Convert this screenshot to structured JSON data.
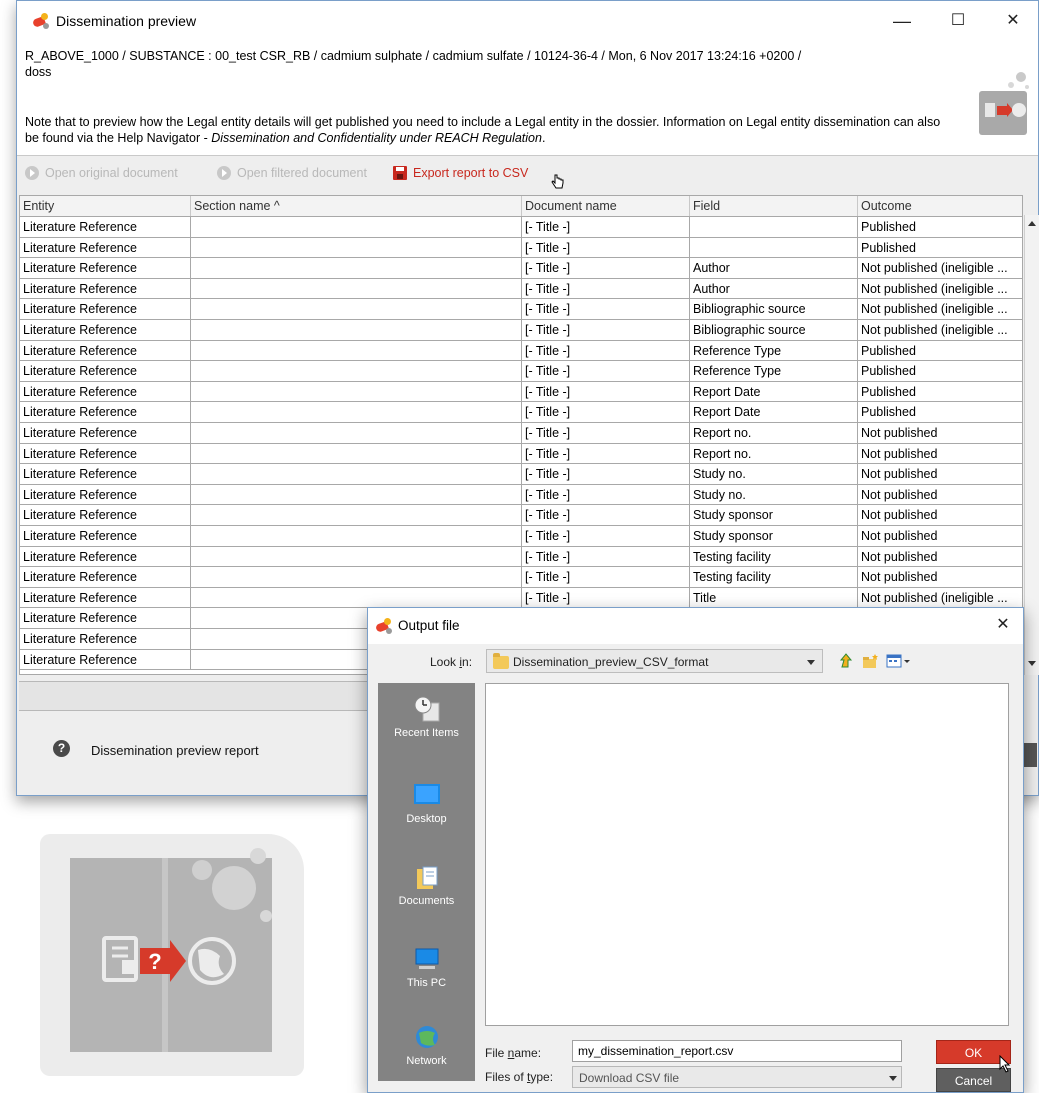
{
  "main_window": {
    "title": "Dissemination preview",
    "minimize": "—",
    "maximize": "☐",
    "close": "✕",
    "header_line1": "R_ABOVE_1000 / SUBSTANCE : 00_test CSR_RB / cadmium sulphate / cadmium sulfate / 10124-36-4 / Mon, 6 Nov 2017 13:24:16 +0200 /",
    "header_line2": "doss",
    "note_part1": "Note that to preview how the Legal entity details will get published you need to include a Legal entity in the dossier. Information on Legal entity dissemination can also be found via the Help Navigator - ",
    "note_italic": "Dissemination and Confidentiality under REACH Regulation",
    "note_end": "."
  },
  "toolbar": {
    "open_original": "Open original document",
    "open_filtered": "Open filtered document",
    "export_csv": "Export report to CSV"
  },
  "table": {
    "columns": [
      "Entity",
      "Section name ^",
      "Document name",
      "Field",
      "Outcome"
    ],
    "rows": [
      [
        "Literature Reference",
        "",
        "[- Title -]",
        "",
        "Published"
      ],
      [
        "Literature Reference",
        "",
        "[- Title -]",
        "",
        "Published"
      ],
      [
        "Literature Reference",
        "",
        "[- Title -]",
        "Author",
        "Not published (ineligible ..."
      ],
      [
        "Literature Reference",
        "",
        "[- Title -]",
        "Author",
        "Not published (ineligible ..."
      ],
      [
        "Literature Reference",
        "",
        "[- Title -]",
        "Bibliographic source",
        "Not published (ineligible ..."
      ],
      [
        "Literature Reference",
        "",
        "[- Title -]",
        "Bibliographic source",
        "Not published (ineligible ..."
      ],
      [
        "Literature Reference",
        "",
        "[- Title -]",
        "Reference Type",
        "Published"
      ],
      [
        "Literature Reference",
        "",
        "[- Title -]",
        "Reference Type",
        "Published"
      ],
      [
        "Literature Reference",
        "",
        "[- Title -]",
        "Report Date",
        "Published"
      ],
      [
        "Literature Reference",
        "",
        "[- Title -]",
        "Report Date",
        "Published"
      ],
      [
        "Literature Reference",
        "",
        "[- Title -]",
        "Report no.",
        "Not published"
      ],
      [
        "Literature Reference",
        "",
        "[- Title -]",
        "Report no.",
        "Not published"
      ],
      [
        "Literature Reference",
        "",
        "[- Title -]",
        "Study no.",
        "Not published"
      ],
      [
        "Literature Reference",
        "",
        "[- Title -]",
        "Study no.",
        "Not published"
      ],
      [
        "Literature Reference",
        "",
        "[- Title -]",
        "Study sponsor",
        "Not published"
      ],
      [
        "Literature Reference",
        "",
        "[- Title -]",
        "Study sponsor",
        "Not published"
      ],
      [
        "Literature Reference",
        "",
        "[- Title -]",
        "Testing facility",
        "Not published"
      ],
      [
        "Literature Reference",
        "",
        "[- Title -]",
        "Testing facility",
        "Not published"
      ],
      [
        "Literature Reference",
        "",
        "[- Title -]",
        "Title",
        "Not published (ineligible ..."
      ],
      [
        "Literature Reference",
        "",
        "",
        "",
        ""
      ],
      [
        "Literature Reference",
        "",
        "",
        "",
        ""
      ],
      [
        "Literature Reference",
        "",
        "",
        "",
        ""
      ]
    ]
  },
  "bottom": {
    "help_icon": "?",
    "report_label": "Dissemination preview report"
  },
  "output_dialog": {
    "title": "Output file",
    "close": "✕",
    "look_in_label": "Look in:",
    "look_in_value": "Dissemination_preview_CSV_format",
    "places": [
      "Recent Items",
      "Desktop",
      "Documents",
      "This PC",
      "Network"
    ],
    "file_name_label": "File name:",
    "file_name_value": "my_dissemination_report.csv",
    "files_of_type_label": "Files of type:",
    "files_of_type_value": "Download CSV file",
    "ok": "OK",
    "cancel": "Cancel"
  },
  "colors": {
    "accent_red": "#d63a2a",
    "window_border": "#7a9fc9",
    "places_bg": "#838383"
  }
}
